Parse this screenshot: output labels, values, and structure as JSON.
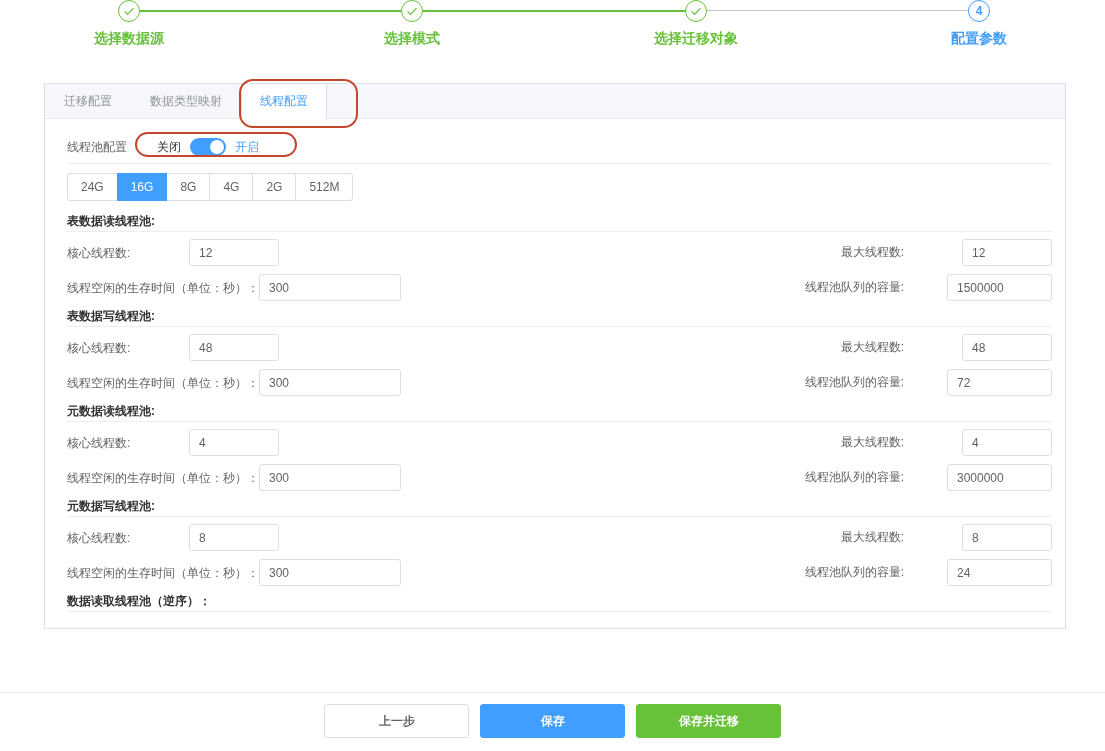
{
  "steps": [
    {
      "label": "选择数据源",
      "completed": true,
      "current": false
    },
    {
      "label": "选择模式",
      "completed": true,
      "current": false
    },
    {
      "label": "选择迁移对象",
      "completed": true,
      "current": false
    },
    {
      "label": "配置参数",
      "completed": false,
      "current": true,
      "number": "4"
    }
  ],
  "tabs": [
    {
      "label": "迁移配置",
      "selected": false,
      "highlighted": false
    },
    {
      "label": "数据类型映射",
      "selected": false,
      "highlighted": false
    },
    {
      "label": "线程配置",
      "selected": true,
      "highlighted": true
    }
  ],
  "thread_pool": {
    "label": "线程池配置",
    "off_label": "关闭",
    "on_label": "开启",
    "on": true,
    "highlighted": true
  },
  "memory_options": [
    {
      "label": "24G",
      "selected": false
    },
    {
      "label": "16G",
      "selected": true
    },
    {
      "label": "8G",
      "selected": false
    },
    {
      "label": "4G",
      "selected": false
    },
    {
      "label": "2G",
      "selected": false
    },
    {
      "label": "512M",
      "selected": false
    }
  ],
  "sections": [
    {
      "title": "表数据读线程池:",
      "rows": [
        {
          "kind": "core",
          "left": {
            "label": "核心线程数:",
            "value": "12"
          },
          "right": {
            "label": "最大线程数:",
            "value": "12"
          }
        },
        {
          "kind": "keepalive",
          "left": {
            "label": "线程空闲的生存时间（单位：秒）：",
            "value": "300"
          },
          "right": {
            "label": "线程池队列的容量:",
            "value": "1500000"
          }
        }
      ]
    },
    {
      "title": "表数据写线程池:",
      "rows": [
        {
          "kind": "core",
          "left": {
            "label": "核心线程数:",
            "value": "48"
          },
          "right": {
            "label": "最大线程数:",
            "value": "48"
          }
        },
        {
          "kind": "keepalive",
          "left": {
            "label": "线程空闲的生存时间（单位：秒）：",
            "value": "300"
          },
          "right": {
            "label": "线程池队列的容量:",
            "value": "72"
          }
        }
      ]
    },
    {
      "title": "元数据读线程池:",
      "rows": [
        {
          "kind": "core",
          "left": {
            "label": "核心线程数:",
            "value": "4"
          },
          "right": {
            "label": "最大线程数:",
            "value": "4"
          }
        },
        {
          "kind": "keepalive",
          "left": {
            "label": "线程空闲的生存时间（单位：秒）：",
            "value": "300"
          },
          "right": {
            "label": "线程池队列的容量:",
            "value": "3000000"
          }
        }
      ]
    },
    {
      "title": "元数据写线程池:",
      "rows": [
        {
          "kind": "core",
          "left": {
            "label": "核心线程数:",
            "value": "8"
          },
          "right": {
            "label": "最大线程数:",
            "value": "8"
          }
        },
        {
          "kind": "keepalive",
          "left": {
            "label": "线程空闲的生存时间（单位：秒）：",
            "value": "300"
          },
          "right": {
            "label": "线程池队列的容量:",
            "value": "24"
          }
        }
      ]
    },
    {
      "title": "数据读取线程池（逆序）："
    }
  ],
  "buttons": [
    {
      "label": "上一步",
      "kind": "default"
    },
    {
      "label": "保存",
      "kind": "primary"
    },
    {
      "label": "保存并迁移",
      "kind": "success"
    }
  ]
}
